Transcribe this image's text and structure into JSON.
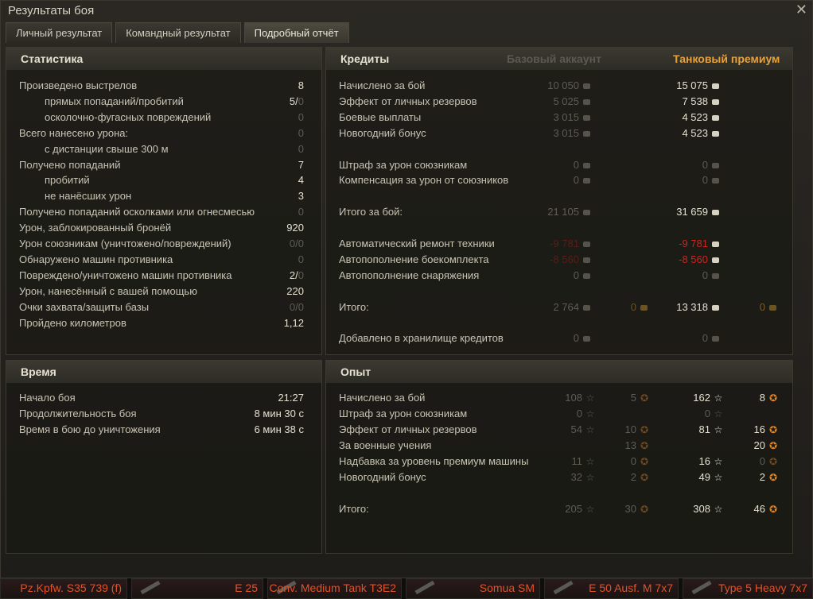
{
  "window": {
    "title": "Результаты боя"
  },
  "tabs": [
    {
      "label": "Личный результат"
    },
    {
      "label": "Командный результат"
    },
    {
      "label": "Подробный отчёт"
    }
  ],
  "statistics": {
    "title": "Статистика",
    "rows": [
      {
        "label": "Произведено выстрелов",
        "value": "8",
        "indent": false,
        "dim": false
      },
      {
        "label": "прямых попаданий/пробитий",
        "value": "5/",
        "value_dim": "0",
        "indent": true,
        "dim": false
      },
      {
        "label": "осколочно-фугасных повреждений",
        "value": "0",
        "indent": true,
        "dim": true
      },
      {
        "label": "Всего нанесено урона:",
        "value": "0",
        "indent": false,
        "dim": true
      },
      {
        "label": "с дистанции свыше 300 м",
        "value": "0",
        "indent": true,
        "dim": true
      },
      {
        "label": "Получено попаданий",
        "value": "7",
        "indent": false,
        "dim": false
      },
      {
        "label": "пробитий",
        "value": "4",
        "indent": true,
        "dim": false
      },
      {
        "label": "не нанёсших урон",
        "value": "3",
        "indent": true,
        "dim": false
      },
      {
        "label": "Получено попаданий осколками или огнесмесью",
        "value": "0",
        "indent": false,
        "dim": true
      },
      {
        "label": "Урон, заблокированный бронёй",
        "value": "920",
        "indent": false,
        "dim": false
      },
      {
        "label": "Урон союзникам (уничтожено/повреждений)",
        "value": "0/0",
        "indent": false,
        "dim": true
      },
      {
        "label": "Обнаружено машин противника",
        "value": "0",
        "indent": false,
        "dim": true
      },
      {
        "label": "Повреждено/уничтожено машин противника",
        "value": "2/",
        "value_dim": "0",
        "indent": false,
        "dim": false
      },
      {
        "label": "Урон, нанесённый с вашей помощью",
        "value": "220",
        "indent": false,
        "dim": false
      },
      {
        "label": "Очки захвата/защиты базы",
        "value": "0/0",
        "indent": false,
        "dim": true
      },
      {
        "label": "Пройдено километров",
        "value": "1,12",
        "indent": false,
        "dim": false
      }
    ]
  },
  "time": {
    "title": "Время",
    "rows": [
      {
        "label": "Начало боя",
        "value": "21:27"
      },
      {
        "label": "Продолжительность боя",
        "value": "8 мин 30 с"
      },
      {
        "label": "Время в бою до уничтожения",
        "value": "6 мин 38 с"
      }
    ]
  },
  "credits": {
    "title": "Кредиты",
    "col_base": "Базовый аккаунт",
    "col_premium": "Танковый премиум",
    "rows": [
      {
        "label": "Начислено за бой",
        "base": "10 050",
        "prem": "15 075",
        "slot": 0
      },
      {
        "label": "Эффект от личных резервов",
        "base": "5 025",
        "prem": "7 538",
        "slot": 1
      },
      {
        "label": "Боевые выплаты",
        "base": "3 015",
        "prem": "4 523",
        "slot": 2
      },
      {
        "label": "Новогодний бонус",
        "base": "3 015",
        "prem": "4 523",
        "slot": 3
      },
      {
        "label": "Штраф за урон союзникам",
        "base": "0",
        "prem": "0",
        "prem_dim": true,
        "slot": 5
      },
      {
        "label": "Компенсация за урон от союзников",
        "base": "0",
        "prem": "0",
        "prem_dim": true,
        "slot": 6
      },
      {
        "label": "Итого за бой:",
        "base": "21 105",
        "prem": "31 659",
        "slot": 8
      },
      {
        "label": "Автоматический ремонт техники",
        "base": "-9 781",
        "prem": "-9 781",
        "red": true,
        "slot": 10
      },
      {
        "label": "Автопополнение боекомплекта",
        "base": "-8 560",
        "prem": "-8 560",
        "red": true,
        "slot": 11
      },
      {
        "label": "Автопополнение снаряжения",
        "base": "0",
        "prem": "0",
        "prem_dim": true,
        "slot": 12
      },
      {
        "label": "Итого:",
        "base": "2 764",
        "base_gold": "0",
        "prem": "13 318",
        "prem_gold": "0",
        "slot": 14
      },
      {
        "label": "Добавлено в хранилище кредитов",
        "base": "0",
        "prem": "0",
        "prem_dim": true,
        "slot": 16
      }
    ]
  },
  "experience": {
    "title": "Опыт",
    "rows": [
      {
        "label": "Начислено за бой",
        "base": "108",
        "base_free": "5",
        "prem": "162",
        "prem_free": "8",
        "slot": 0
      },
      {
        "label": "Штраф за урон союзникам",
        "base": "0",
        "prem": "0",
        "prem_dim": true,
        "slot": 1
      },
      {
        "label": "Эффект от личных резервов",
        "base": "54",
        "base_free": "10",
        "prem": "81",
        "prem_free": "16",
        "slot": 2
      },
      {
        "label": "За военные учения",
        "base_free": "13",
        "prem_free": "20",
        "slot": 3
      },
      {
        "label": "Надбавка за уровень премиум машины",
        "base": "11",
        "base_free": "0",
        "prem": "16",
        "prem_free": "0",
        "prem_free_dim": true,
        "slot": 4
      },
      {
        "label": "Новогодний бонус",
        "base": "32",
        "base_free": "2",
        "prem": "49",
        "prem_free": "2",
        "slot": 5
      },
      {
        "label": "Итого:",
        "base": "205",
        "base_free": "30",
        "prem": "308",
        "prem_free": "46",
        "slot": 7
      }
    ]
  },
  "carousel": [
    {
      "label": "Pz.Kpfw. S35 739 (f)"
    },
    {
      "label": "E 25"
    },
    {
      "label": "Conv. Medium Tank T3E2"
    },
    {
      "label": "Somua SM"
    },
    {
      "label": "E 50 Ausf. M 7x7"
    },
    {
      "label": "Type 5 Heavy 7x7"
    }
  ]
}
